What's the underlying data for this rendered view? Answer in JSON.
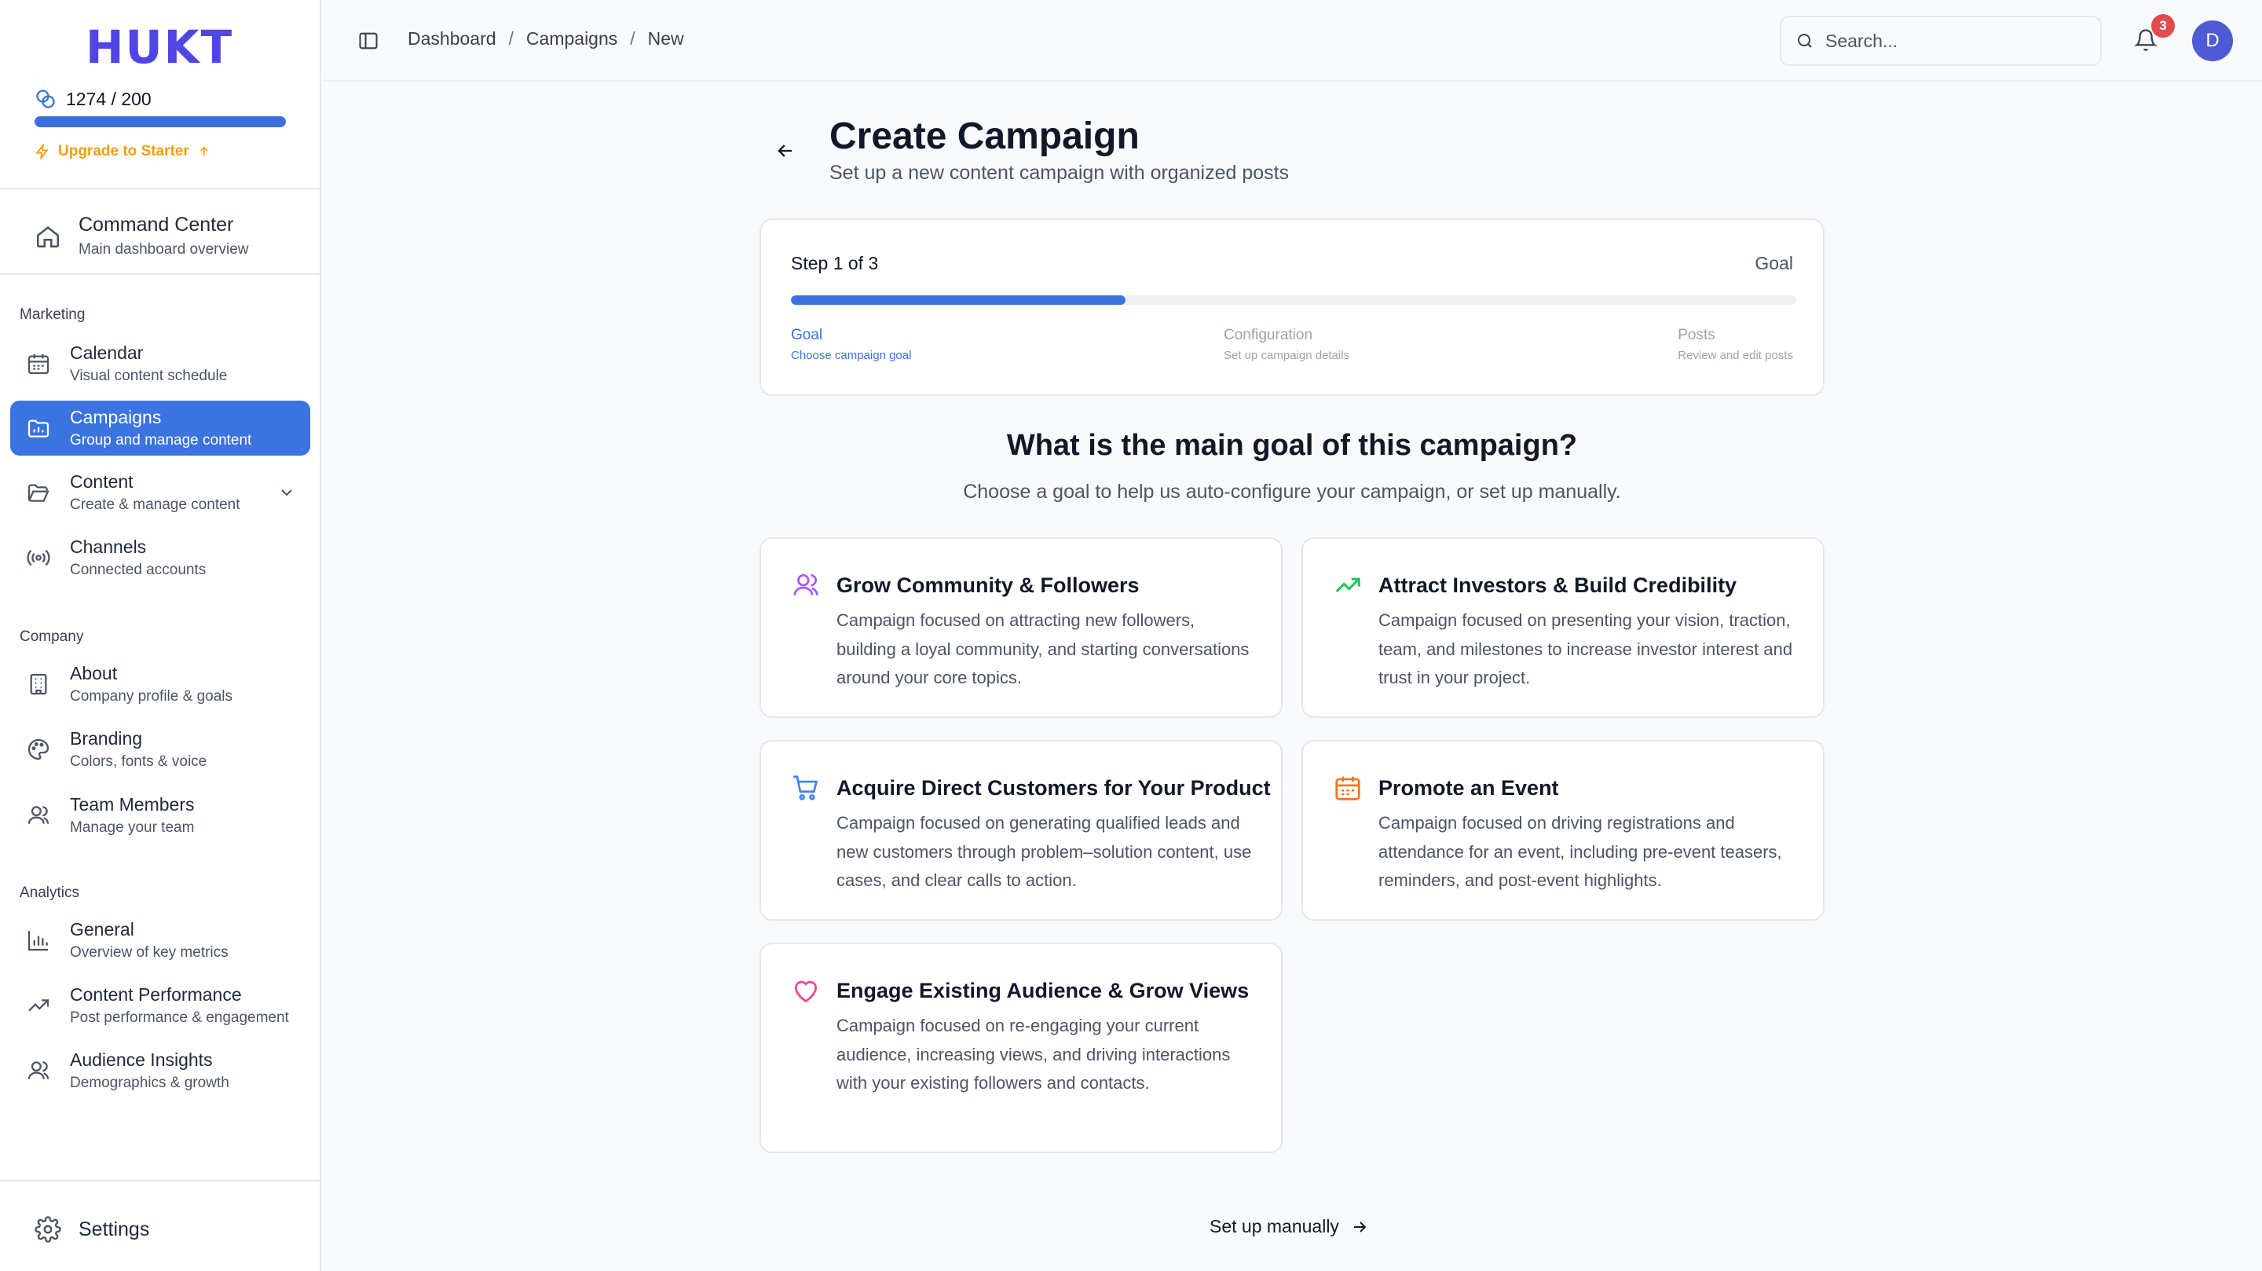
{
  "sidebar": {
    "logo": "HUKT",
    "credits": "1274 / 200",
    "credits_progress": 1.0,
    "upgrade_label": "Upgrade to Starter",
    "command_center": {
      "title": "Command Center",
      "subtitle": "Main dashboard overview"
    },
    "sections": {
      "marketing": "Marketing",
      "company": "Company",
      "analytics": "Analytics"
    },
    "items": {
      "calendar": {
        "title": "Calendar",
        "subtitle": "Visual content schedule"
      },
      "campaigns": {
        "title": "Campaigns",
        "subtitle": "Group and manage content"
      },
      "content": {
        "title": "Content",
        "subtitle": "Create & manage content"
      },
      "channels": {
        "title": "Channels",
        "subtitle": "Connected accounts"
      },
      "about": {
        "title": "About",
        "subtitle": "Company profile & goals"
      },
      "branding": {
        "title": "Branding",
        "subtitle": "Colors, fonts & voice"
      },
      "team": {
        "title": "Team Members",
        "subtitle": "Manage your team"
      },
      "general": {
        "title": "General",
        "subtitle": "Overview of key metrics"
      },
      "performance": {
        "title": "Content Performance",
        "subtitle": "Post performance & engagement"
      },
      "audience": {
        "title": "Audience Insights",
        "subtitle": "Demographics & growth"
      }
    },
    "settings_label": "Settings"
  },
  "topbar": {
    "breadcrumb": [
      "Dashboard",
      "Campaigns",
      "New"
    ],
    "separator": "/",
    "search_placeholder": "Search...",
    "notification_count": "3",
    "avatar_initial": "D"
  },
  "page": {
    "title": "Create Campaign",
    "subtitle": "Set up a new content campaign with organized posts"
  },
  "stepper": {
    "step_count": "Step 1 of 3",
    "current_label": "Goal",
    "progress": 0.333,
    "steps": [
      {
        "name": "Goal",
        "desc": "Choose campaign goal"
      },
      {
        "name": "Configuration",
        "desc": "Set up campaign details"
      },
      {
        "name": "Posts",
        "desc": "Review and edit posts"
      }
    ]
  },
  "question": {
    "title": "What is the main goal of this campaign?",
    "subtitle": "Choose a goal to help us auto-configure your campaign, or set up manually."
  },
  "goals": [
    {
      "title": "Grow Community & Followers",
      "desc": "Campaign focused on attracting new followers, building a loyal community, and starting conversations around your core topics.",
      "icon": "users-icon",
      "color": "#a855f7"
    },
    {
      "title": "Attract Investors & Build Credibility",
      "desc": "Campaign focused on presenting your vision, traction, team, and milestones to increase investor interest and trust in your project.",
      "icon": "trending-up-icon",
      "color": "#22c55e"
    },
    {
      "title": "Acquire Direct Customers for Your Product",
      "desc": "Campaign focused on generating qualified leads and new customers through problem–solution content, use cases, and clear calls to action.",
      "icon": "cart-icon",
      "color": "#3b82f6"
    },
    {
      "title": "Promote an Event",
      "desc": "Campaign focused on driving registrations and attendance for an event, including pre-event teasers, reminders, and post-event highlights.",
      "icon": "calendar-icon",
      "color": "#f97316"
    },
    {
      "title": "Engage Existing Audience & Grow Views",
      "desc": "Campaign focused on re-engaging your current audience, increasing views, and driving interactions with your existing followers and contacts.",
      "icon": "heart-icon",
      "color": "#ec4899"
    }
  ],
  "manual_label": "Set up manually"
}
